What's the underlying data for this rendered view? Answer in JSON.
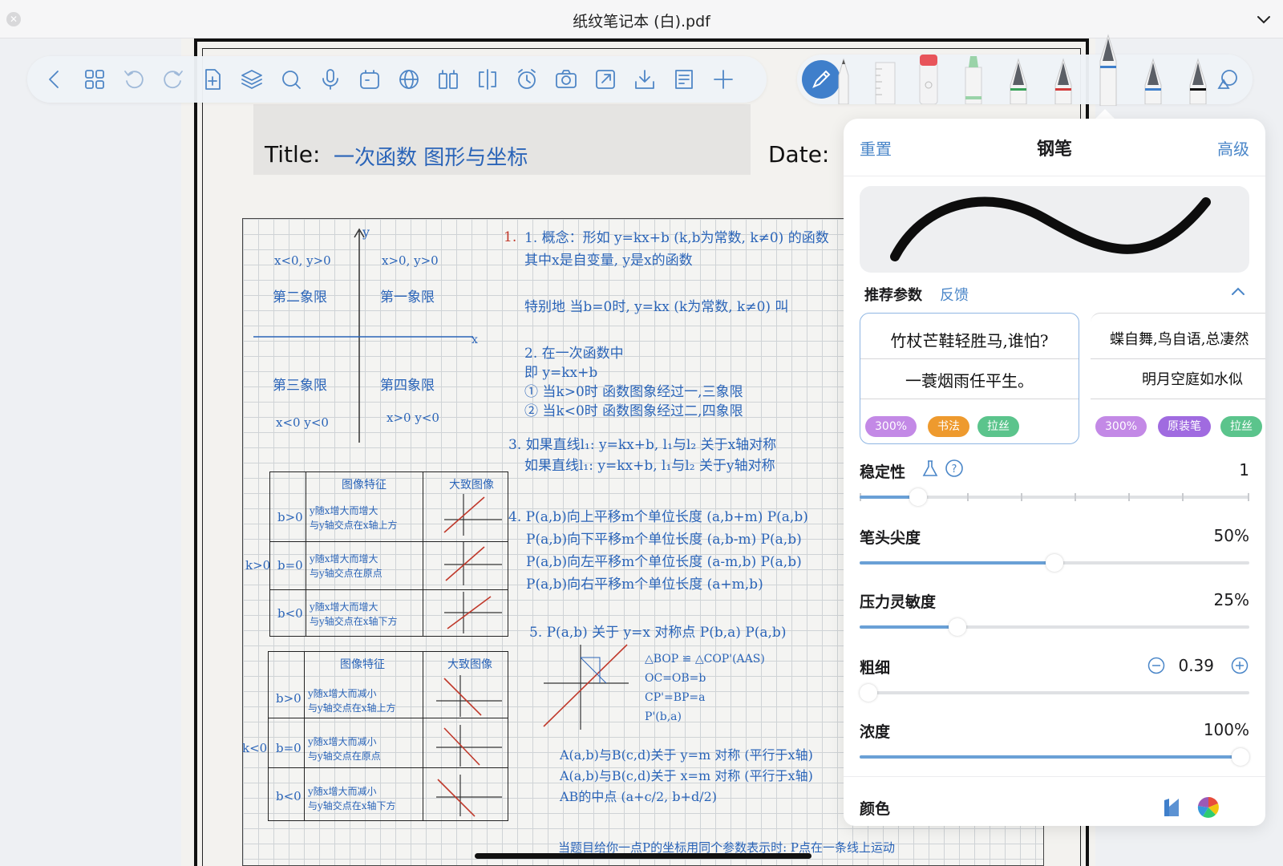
{
  "window": {
    "title": "纸纹笔记本 (白).pdf"
  },
  "document": {
    "title_label": "Title:",
    "title_value": "一次函数 图形与坐标",
    "date_label": "Date:",
    "notes": [
      "1. 概念：形如 y=kx+b (k,b为常数, k≠0) 的函数",
      "其中x是自变量, y是x的函数",
      "特别地 当b=0时, y=kx (k为常数, k≠0) 叫",
      "2. 在一次函数中",
      "即 y=kx+b",
      "① 当k>0时  函数图象经过一,三象限",
      "② 当k<0时  函数图象经过二,四象限",
      "3. 如果直线l₁: y=kx+b, l₁与l₂ 关于x轴对称",
      "如果直线l₁: y=kx+b, l₁与l₂ 关于y轴对称",
      "4. P(a,b)向上平移m个单位长度 (a,b+m)  P(a,b)",
      "P(a,b)向下平移m个单位长度 (a,b-m)  P(a,b)",
      "P(a,b)向左平移m个单位长度 (a-m,b)  P(a,b)",
      "P(a,b)向右平移m个单位长度 (a+m,b)",
      "5. P(a,b) 关于 y=x 对称点 P(b,a)  P(a,b)",
      "△BOP ≌ △COP'(AAS)",
      "OC=OB=b",
      "CP'=BP=a",
      "P'(b,a)",
      "A(a,b)与B(c,d)关于 y=m 对称 (平行于x轴)",
      "A(a,b)与B(c,d)关于 x=m 对称 (平行于x轴)",
      "AB的中点 (a+c/2, b+d/2)",
      "当题目给你一点P的坐标用同个参数表示时: P点在一条线上运动"
    ],
    "quadrants": {
      "y_axis": "y",
      "x_axis": "x",
      "q2_sign": "x<0, y>0",
      "q1_sign": "x>0, y>0",
      "q2_name": "第二象限",
      "q1_name": "第一象限",
      "q3_name": "第三象限",
      "q4_name": "第四象限",
      "q3_sign": "x<0 y<0",
      "q4_sign": "x>0 y<0"
    },
    "table1": {
      "h1": "图像特征",
      "h2": "大致图像",
      "side": "k>0",
      "rows": [
        {
          "cond": "b>0",
          "desc1": "y随x增大而增大",
          "desc2": "与y轴交点在x轴上方"
        },
        {
          "cond": "b=0",
          "desc1": "y随x增大而增大",
          "desc2": "与y轴交点在原点"
        },
        {
          "cond": "b<0",
          "desc1": "y随x增大而增大",
          "desc2": "与y轴交点在x轴下方"
        }
      ]
    },
    "table2": {
      "h1": "图像特征",
      "h2": "大致图像",
      "side": "k<0",
      "rows": [
        {
          "cond": "b>0",
          "desc1": "y随x增大而减小",
          "desc2": "与y轴交点在x轴上方"
        },
        {
          "cond": "b=0",
          "desc1": "y随x增大而减小",
          "desc2": "与y轴交点在原点"
        },
        {
          "cond": "b<0",
          "desc1": "y随x增大而减小",
          "desc2": "与y轴交点在x轴下方"
        }
      ]
    }
  },
  "toolbar": {
    "icons": [
      "back-icon",
      "grid-icon",
      "undo-icon",
      "redo-icon",
      "add-page-icon",
      "layers-icon",
      "search-icon",
      "microphone-icon",
      "sticker-icon",
      "globe-icon",
      "book-icon",
      "split-icon",
      "timer-icon",
      "camera-icon",
      "export-icon",
      "download-icon",
      "notes-icon",
      "plus-icon"
    ]
  },
  "pen_popover": {
    "reset": "重置",
    "title": "钢笔",
    "advanced": "高级",
    "recommended": "推荐参数",
    "feedback": "反馈",
    "presets": [
      {
        "line1": "竹杖芒鞋轻胜马,谁怕?",
        "line2": "一蓑烟雨任平生。",
        "tags": [
          "300%",
          "书法",
          "拉丝"
        ]
      },
      {
        "line1": "蝶自舞,鸟自语,总凄然",
        "line2": "明月空庭如水似",
        "tags": [
          "300%",
          "原装笔",
          "拉丝"
        ]
      }
    ],
    "stability": {
      "label": "稳定性",
      "value": "1",
      "fraction": 0.15
    },
    "tip_sharpness": {
      "label": "笔头尖度",
      "value": "50%",
      "fraction": 0.5
    },
    "pressure": {
      "label": "压力灵敏度",
      "value": "25%",
      "fraction": 0.25
    },
    "thickness": {
      "label": "粗细",
      "value": "0.39",
      "fraction": 0.02
    },
    "opacity": {
      "label": "浓度",
      "value": "100%",
      "fraction": 1.0
    },
    "color_label": "颜色"
  },
  "colors": {
    "accent": "#4a86c8",
    "ink_blue": "#2a64b8",
    "ink_red": "#c0392b"
  }
}
